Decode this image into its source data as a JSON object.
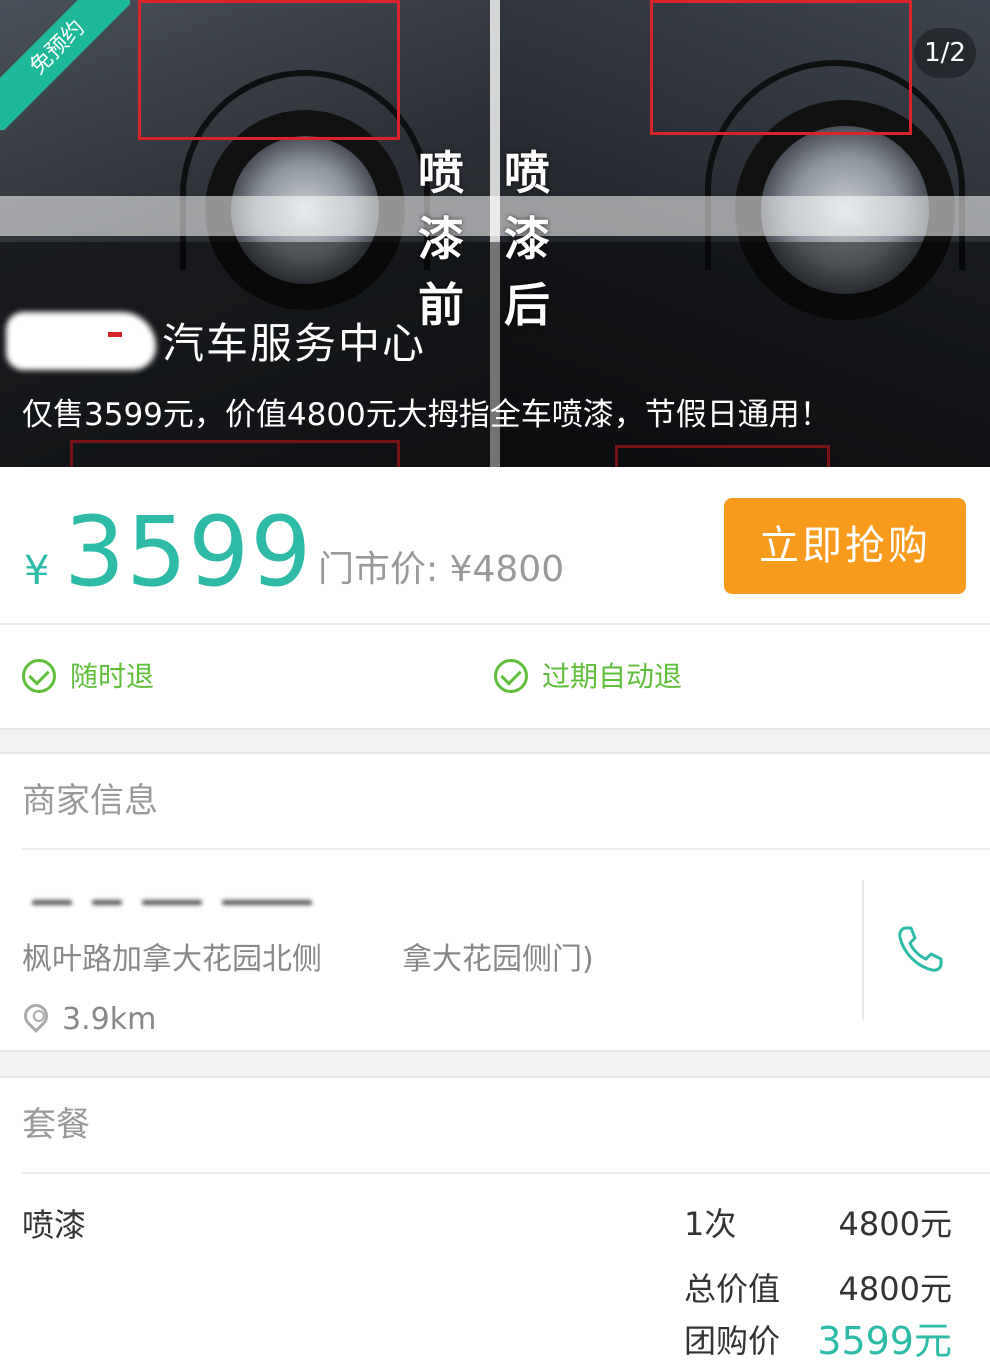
{
  "hero": {
    "badge": "免预约",
    "counter": "1/2",
    "before_label": [
      "喷",
      "漆",
      "前"
    ],
    "after_label": [
      "喷",
      "漆",
      "后"
    ],
    "shop_name": "汽车服务中心",
    "promo_text": "仅售3599元，价值4800元大拇指全车喷漆，节假日通用！"
  },
  "price": {
    "currency": "¥",
    "amount": "3599",
    "original_label": "门市价: ¥4800",
    "buy_label": "立即抢购"
  },
  "refund": {
    "anytime": "随时退",
    "expired": "过期自动退"
  },
  "merchant": {
    "section_title": "商家信息",
    "address_start": "枫叶路加拿大花园北侧",
    "address_end": "拿大花园侧门)",
    "distance": "3.9km"
  },
  "package": {
    "section_title": "套餐",
    "item_name": "喷漆",
    "item_qty": "1次",
    "item_price": "4800元",
    "total_label": "总价值",
    "total_value": "4800元",
    "group_label": "团购价",
    "group_value": "3599元"
  },
  "colors": {
    "accent_teal": "#2dbba7",
    "buy_orange": "#f89b1c",
    "refund_green": "#5fbf3c"
  }
}
